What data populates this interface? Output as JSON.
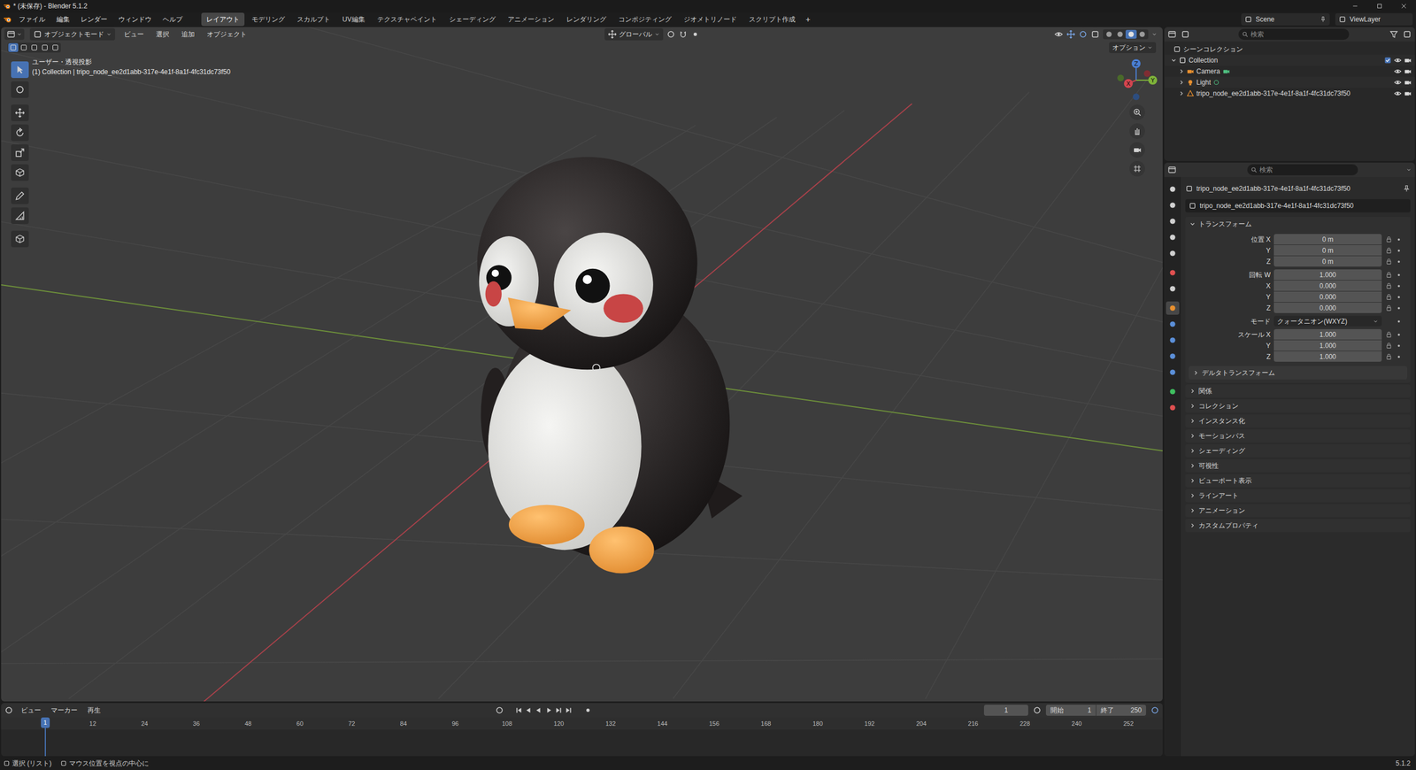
{
  "window": {
    "title": "* (未保存) - Blender 5.1.2"
  },
  "menus": [
    "ファイル",
    "編集",
    "レンダー",
    "ウィンドウ",
    "ヘルプ"
  ],
  "workspaces": [
    {
      "label": "レイアウト",
      "selected": true
    },
    {
      "label": "モデリング",
      "selected": false
    },
    {
      "label": "スカルプト",
      "selected": false
    },
    {
      "label": "UV編集",
      "selected": false
    },
    {
      "label": "テクスチャペイント",
      "selected": false
    },
    {
      "label": "シェーディング",
      "selected": false
    },
    {
      "label": "アニメーション",
      "selected": false
    },
    {
      "label": "レンダリング",
      "selected": false
    },
    {
      "label": "コンポジティング",
      "selected": false
    },
    {
      "label": "ジオメトリノード",
      "selected": false
    },
    {
      "label": "スクリプト作成",
      "selected": false
    }
  ],
  "add_workspace": "+",
  "scene": "Scene",
  "view_layer": "ViewLayer",
  "viewport": {
    "mode": "オブジェクトモード",
    "menus": [
      "ビュー",
      "選択",
      "追加",
      "オブジェクト"
    ],
    "orientation": "グローバル",
    "options": "オプション",
    "view_name": "ユーザー・透視投影",
    "info": "(1) Collection | tripo_node_ee2d1abb-317e-4e1f-8a1f-4fc31dc73f50",
    "gizmo": {
      "x": "X",
      "y": "Y",
      "z": "Z"
    },
    "select_modes": [
      {
        "selected": true
      },
      {
        "selected": false
      },
      {
        "selected": false
      },
      {
        "selected": false
      },
      {
        "selected": false
      }
    ],
    "shading_modes": [
      {
        "selected": false
      },
      {
        "selected": false
      },
      {
        "selected": true
      },
      {
        "selected": false
      }
    ],
    "tools": [
      {
        "selected": true
      },
      {
        "selected": false
      },
      {
        "selected": false
      },
      {
        "selected": false
      },
      {
        "selected": false
      },
      {
        "selected": false
      },
      {
        "selected": false
      },
      {
        "selected": false
      },
      {
        "selected": false
      }
    ]
  },
  "outliner": {
    "search": "検索",
    "root": "シーンコレクション",
    "items": [
      {
        "label": "Collection",
        "kind": "collection",
        "expanded": true,
        "checked": true,
        "visible": true,
        "renderable": true
      },
      {
        "label": "Camera",
        "kind": "camera",
        "expanded": false,
        "checked": false,
        "visible": true,
        "renderable": true
      },
      {
        "label": "Light",
        "kind": "light",
        "expanded": false,
        "checked": false,
        "visible": true,
        "renderable": true
      },
      {
        "label": "tripo_node_ee2d1abb-317e-4e1f-8a1f-4fc31dc73f50",
        "kind": "mesh",
        "expanded": false,
        "checked": false,
        "visible": true,
        "renderable": true
      }
    ]
  },
  "properties": {
    "search": "検索",
    "object": "tripo_node_ee2d1abb-317e-4e1f-8a1f-4fc31dc73f50",
    "data_name": "tripo_node_ee2d1abb-317e-4e1f-8a1f-4fc31dc73f50",
    "tabs": [
      {
        "selected": false,
        "color": "#cfcfcf"
      },
      {
        "selected": false,
        "color": "#cfcfcf"
      },
      {
        "selected": false,
        "color": "#cfcfcf"
      },
      {
        "selected": false,
        "color": "#cfcfcf"
      },
      {
        "selected": false,
        "color": "#cfcfcf"
      },
      {
        "selected": false,
        "color": "#e05050"
      },
      {
        "selected": false,
        "color": "#cfcfcf"
      },
      {
        "selected": true,
        "color": "#e8902f"
      },
      {
        "selected": false,
        "color": "#5b8fd8"
      },
      {
        "selected": false,
        "color": "#5b8fd8"
      },
      {
        "selected": false,
        "color": "#5b8fd8"
      },
      {
        "selected": false,
        "color": "#5b8fd8"
      },
      {
        "selected": false,
        "color": "#3fbf60"
      },
      {
        "selected": false,
        "color": "#e05050"
      }
    ],
    "transform": {
      "title": "トランスフォーム",
      "expanded": true,
      "groups": [
        {
          "kind": "field",
          "rows": [
            {
              "label": "位置 X",
              "value": "0 m"
            },
            {
              "label": "Y",
              "value": "0 m"
            },
            {
              "label": "Z",
              "value": "0 m"
            }
          ]
        },
        {
          "kind": "field",
          "rows": [
            {
              "label": "回転 W",
              "value": "1.000"
            },
            {
              "label": "X",
              "value": "0.000"
            },
            {
              "label": "Y",
              "value": "0.000"
            },
            {
              "label": "Z",
              "value": "0.000"
            }
          ]
        },
        {
          "kind": "dropdown",
          "rows": [
            {
              "label": "モード",
              "value": "クォータニオン(WXYZ)"
            }
          ]
        },
        {
          "kind": "field",
          "rows": [
            {
              "label": "スケール X",
              "value": "1.000"
            },
            {
              "label": "Y",
              "value": "1.000"
            },
            {
              "label": "Z",
              "value": "1.000"
            }
          ]
        }
      ],
      "subpanels": [
        {
          "label": "デルタトランスフォーム",
          "expanded": false
        }
      ]
    },
    "panels": [
      {
        "label": "関係",
        "expanded": false
      },
      {
        "label": "コレクション",
        "expanded": false
      },
      {
        "label": "インスタンス化",
        "expanded": false
      },
      {
        "label": "モーションパス",
        "expanded": false
      },
      {
        "label": "シェーディング",
        "expanded": false
      },
      {
        "label": "可視性",
        "expanded": false
      },
      {
        "label": "ビューポート表示",
        "expanded": false
      },
      {
        "label": "ラインアート",
        "expanded": false
      },
      {
        "label": "アニメーション",
        "expanded": false
      },
      {
        "label": "カスタムプロパティ",
        "expanded": false
      }
    ]
  },
  "timeline": {
    "menus": [
      "ビュー",
      "マーカー",
      "再生"
    ],
    "frame_field": "1",
    "start_label": "開始",
    "start": "1",
    "end_label": "終了",
    "end": "250",
    "playhead": "1",
    "ticks": [
      "12",
      "24",
      "36",
      "48",
      "60",
      "72",
      "84",
      "96",
      "108",
      "120",
      "132",
      "144",
      "156",
      "168",
      "180",
      "192",
      "204",
      "216",
      "228",
      "240",
      "252"
    ]
  },
  "status_bar": {
    "items": [
      "選択 (リスト)",
      "マウス位置を視点の中心に"
    ],
    "version": "5.1.2"
  }
}
